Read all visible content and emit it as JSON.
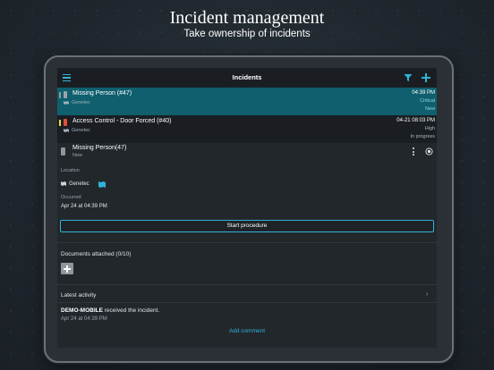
{
  "promo": {
    "headline": "Incident management",
    "subline": "Take ownership of incidents"
  },
  "topbar": {
    "title": "Incidents",
    "menu_icon": "hamburger-icon",
    "filter_icon": "filter-icon",
    "add_icon": "plus-icon"
  },
  "incidents": [
    {
      "name": "Missing Person (#47)",
      "source": "Genetec",
      "time": "04:39 PM",
      "priority": "Critical",
      "state": "New",
      "stripe_color": "#8e979d",
      "selected": true
    },
    {
      "name": "Access Control - Door Forced  (#40)",
      "source": "Genetec",
      "time": "04-21 08:03 PM",
      "priority": "High",
      "state": "In progress",
      "stripe_color": "#e8d84a",
      "icon_color": "#e0503a",
      "selected": false
    }
  ],
  "detail": {
    "name": "Missing Person(47)",
    "state": "New",
    "location_label": "Location",
    "location_value": "Genetec",
    "occurred_label": "Occurred",
    "occurred_value": "Apr 24 at 04:39 PM",
    "start_procedure": "Start procedure",
    "documents_label": "Documents attached (0/10)",
    "latest_activity_label": "Latest activity",
    "activity_user": "DEMO-MOBILE",
    "activity_text": " received the incident.",
    "activity_time": "Apr 24 at 04:39 PM",
    "add_comment": "Add comment"
  },
  "colors": {
    "accent": "#2fb3d6",
    "selected_row": "#0f5f6e",
    "screen_bg": "#1e2328"
  }
}
